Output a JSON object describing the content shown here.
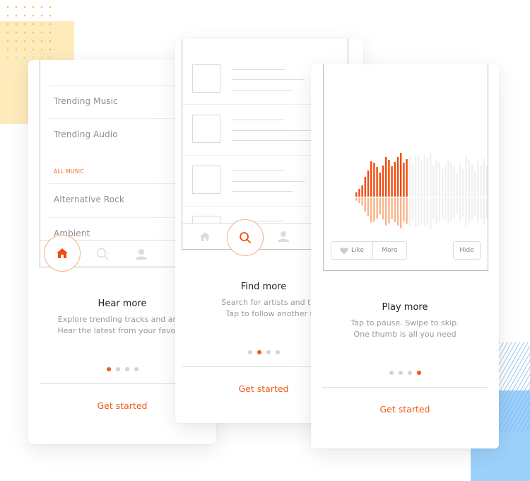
{
  "colors": {
    "accent": "#f25a16",
    "accent_light": "#f7a57a",
    "text_primary": "#222222",
    "text_secondary": "#9a9a9a",
    "inactive_dot": "#d3d3d3",
    "wave_played": "#f24a0c",
    "wave_played_reflection": "#f9b48c",
    "wave_unplayed": "#f0f0f0"
  },
  "cards": [
    {
      "screen": {
        "list_items": [
          "Trending Music",
          "Trending Audio"
        ],
        "section_header": "ALL MUSIC",
        "section_items": [
          "Alternative Rock",
          "Ambient"
        ],
        "tabs": [
          {
            "icon": "home-icon",
            "active": true
          },
          {
            "icon": "search-icon",
            "active": false
          },
          {
            "icon": "user-icon",
            "active": false
          }
        ]
      },
      "title": "Hear more",
      "description": [
        "Explore trending tracks and artists",
        "Hear the latest from your favorites"
      ],
      "page_indicator": {
        "total": 4,
        "active": 1
      },
      "cta": "Get started"
    },
    {
      "screen": {
        "result_rows": 4,
        "tabs": [
          {
            "icon": "home-icon",
            "active": false
          },
          {
            "icon": "search-icon",
            "active": true
          },
          {
            "icon": "user-icon",
            "active": false
          }
        ]
      },
      "title": "Find more",
      "description": [
        "Search for artists and tracks",
        "Tap to follow another user"
      ],
      "page_indicator": {
        "total": 4,
        "active": 2
      },
      "cta": "Get started"
    },
    {
      "screen": {
        "waveform": {
          "played_fraction": 0.4,
          "bars": [
            6,
            11,
            16,
            28,
            37,
            50,
            48,
            42,
            34,
            44,
            56,
            52,
            43,
            49,
            56,
            62,
            48,
            53,
            58,
            49,
            59,
            57,
            52,
            58,
            54,
            61,
            44,
            53,
            48,
            40,
            44,
            53,
            48,
            43,
            33,
            46,
            39,
            57,
            52,
            47,
            37,
            51,
            44,
            54,
            43
          ]
        },
        "buttons": {
          "like": "Like",
          "more": "More",
          "hide": "Hide"
        }
      },
      "title": "Play more",
      "description": [
        "Tap to pause. Swipe to skip.",
        "One thumb is all you need"
      ],
      "page_indicator": {
        "total": 4,
        "active": 4
      },
      "cta": "Get started"
    }
  ]
}
